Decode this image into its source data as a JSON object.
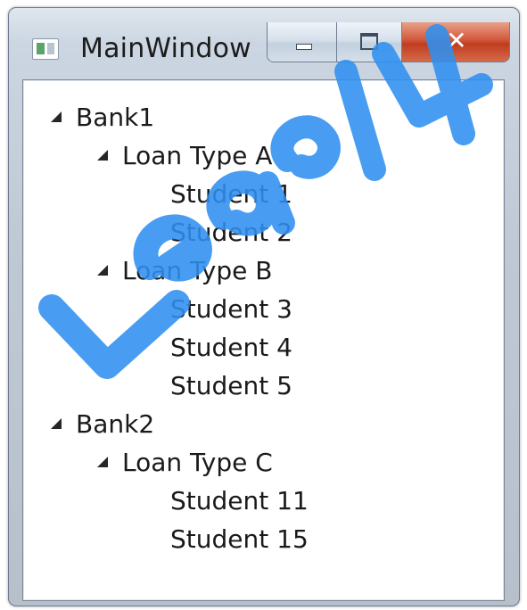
{
  "window": {
    "title": "MainWindow",
    "icon": "window-app-icon",
    "caption_buttons": [
      {
        "name": "minimize",
        "icon": "minimize-icon"
      },
      {
        "name": "maximize",
        "icon": "maximize-icon"
      },
      {
        "name": "close",
        "icon": "close-icon"
      }
    ]
  },
  "tree": {
    "expander_icon": "expanded-triangle-icon",
    "banks": [
      {
        "label": "Bank1",
        "loan_types": [
          {
            "label": "Loan Type A",
            "students": [
              "Student 1",
              "Student 2"
            ]
          },
          {
            "label": "Loan Type B",
            "students": [
              "Student 3",
              "Student 4",
              "Student 5"
            ]
          }
        ]
      },
      {
        "label": "Bank2",
        "loan_types": [
          {
            "label": "Loan Type C",
            "students": [
              "Student 11",
              "Student 15"
            ]
          }
        ]
      }
    ]
  },
  "watermark": {
    "color": "#2f90f0"
  },
  "colors": {
    "close_button": "#c94a2c",
    "frame": "#c3ccd6"
  }
}
